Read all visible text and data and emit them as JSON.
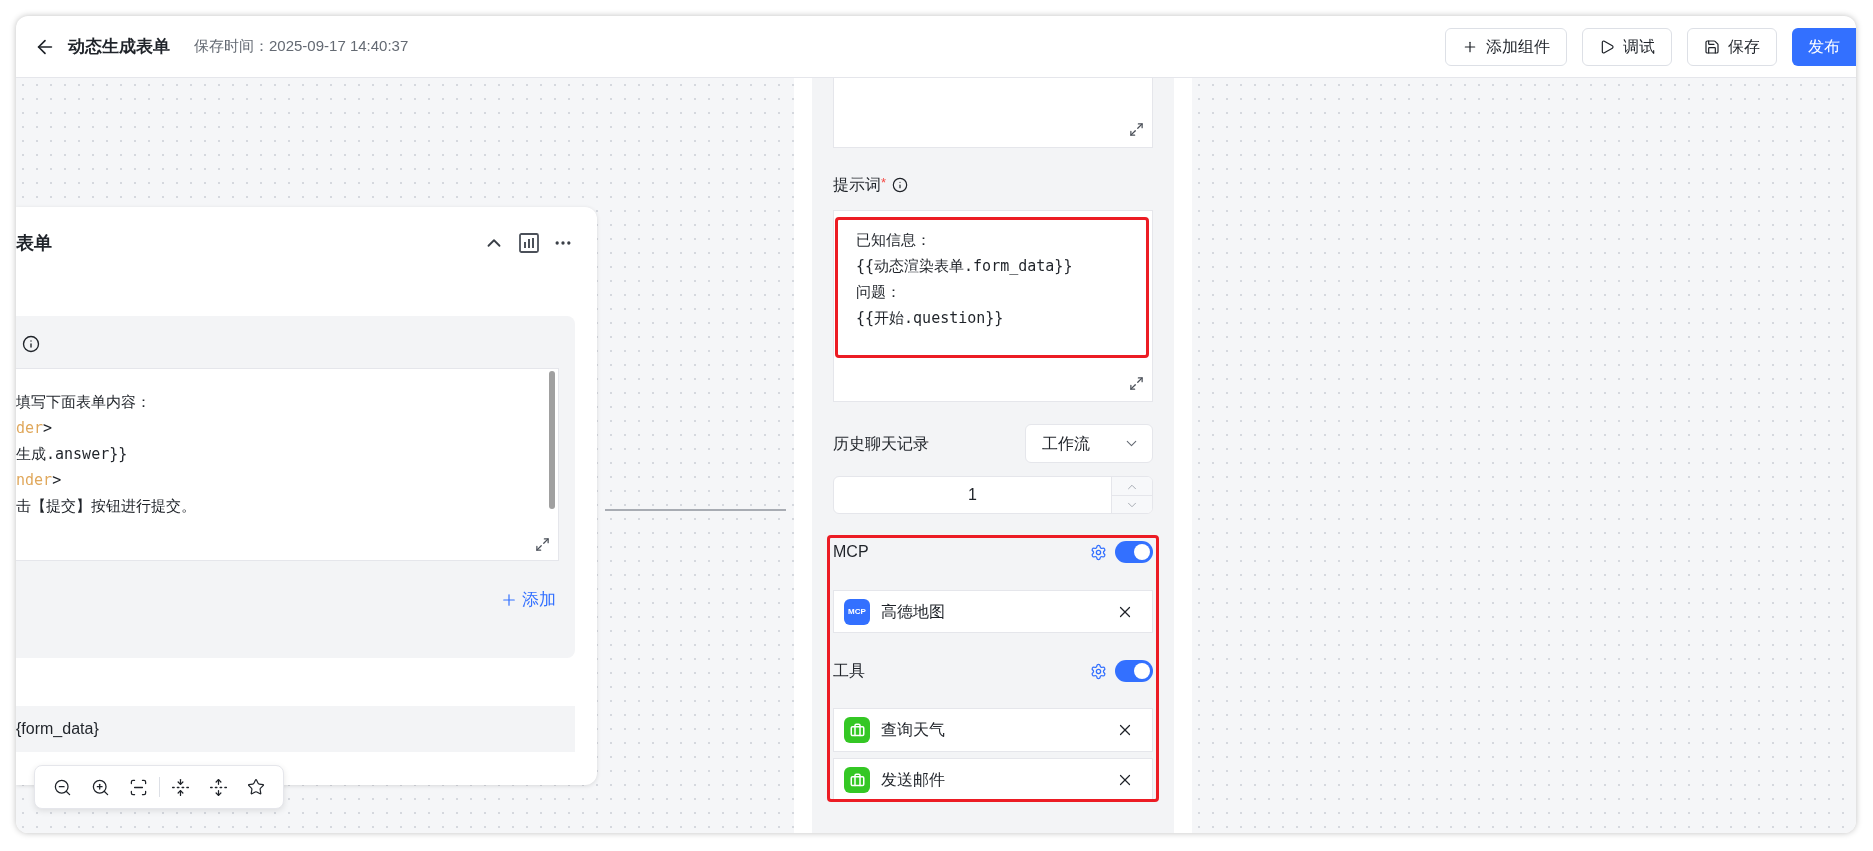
{
  "header": {
    "title": "动态生成表单",
    "save_time": "保存时间：2025-09-17 14:40:37",
    "buttons": [
      {
        "label": "添加组件",
        "kind": "add"
      },
      {
        "label": "调试",
        "kind": "run"
      },
      {
        "label": "保存",
        "kind": "save"
      },
      {
        "label": "发布",
        "kind": "publish"
      }
    ]
  },
  "node_card": {
    "title": "表单",
    "textarea_lines": [
      [
        {
          "text": "填写下面表单内容：",
          "kind": "plain"
        }
      ],
      [
        {
          "text": "der",
          "kind": "tag"
        },
        {
          "text": ">",
          "kind": "plain"
        }
      ],
      [
        {
          "text": "生成.answer}}",
          "kind": "plain"
        }
      ],
      [
        {
          "text": "nder",
          "kind": "tag"
        },
        {
          "text": ">",
          "kind": "plain"
        }
      ],
      [
        {
          "text": "击【提交】按钮进行提交。",
          "kind": "plain"
        }
      ]
    ],
    "add_link": "添加",
    "output": "{form_data}"
  },
  "settings_panel": {
    "prompt": {
      "label": "提示词",
      "required_mark": "*",
      "highlighted": true,
      "lines": [
        "已知信息：",
        "{{动态渲染表单.form_data}}",
        "问题：",
        "{{开始.question}}"
      ]
    },
    "history": {
      "label": "历史聊天记录",
      "select_value": "工作流",
      "count": "1"
    },
    "tools_section": {
      "highlighted": true,
      "groups": [
        {
          "label": "MCP",
          "on": true,
          "items": [
            {
              "kind": "mcp",
              "badge": "MCP",
              "name": "高德地图"
            }
          ]
        },
        {
          "label": "工具",
          "on": true,
          "items": [
            {
              "kind": "tool",
              "name": "查询天气"
            },
            {
              "kind": "tool",
              "name": "发送邮件"
            }
          ]
        }
      ]
    }
  }
}
